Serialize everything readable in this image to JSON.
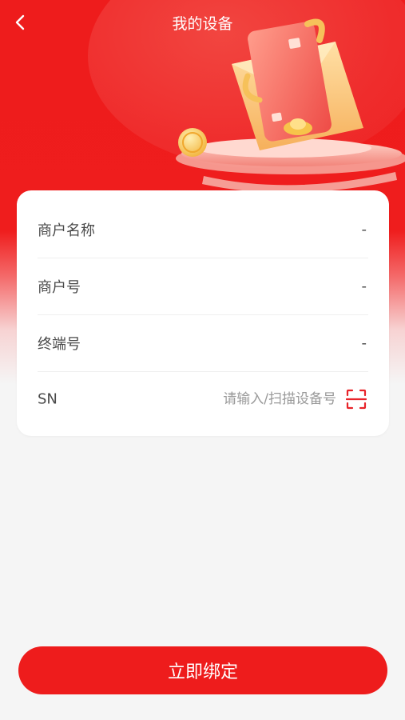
{
  "header": {
    "title": "我的设备",
    "back_icon": "chevron-left-icon"
  },
  "device_info": {
    "merchant_name": {
      "label": "商户名称",
      "value": "-"
    },
    "merchant_no": {
      "label": "商户号",
      "value": "-"
    },
    "terminal_no": {
      "label": "终端号",
      "value": "-"
    },
    "sn": {
      "label": "SN",
      "value": "",
      "placeholder": "请输入/扫描设备号",
      "scan_icon": "scan-icon"
    }
  },
  "actions": {
    "bind_label": "立即绑定"
  },
  "colors": {
    "brand": "#ee1c1c",
    "background": "#f5f5f5",
    "text": "#4a4a4a",
    "placeholder": "#999999"
  }
}
